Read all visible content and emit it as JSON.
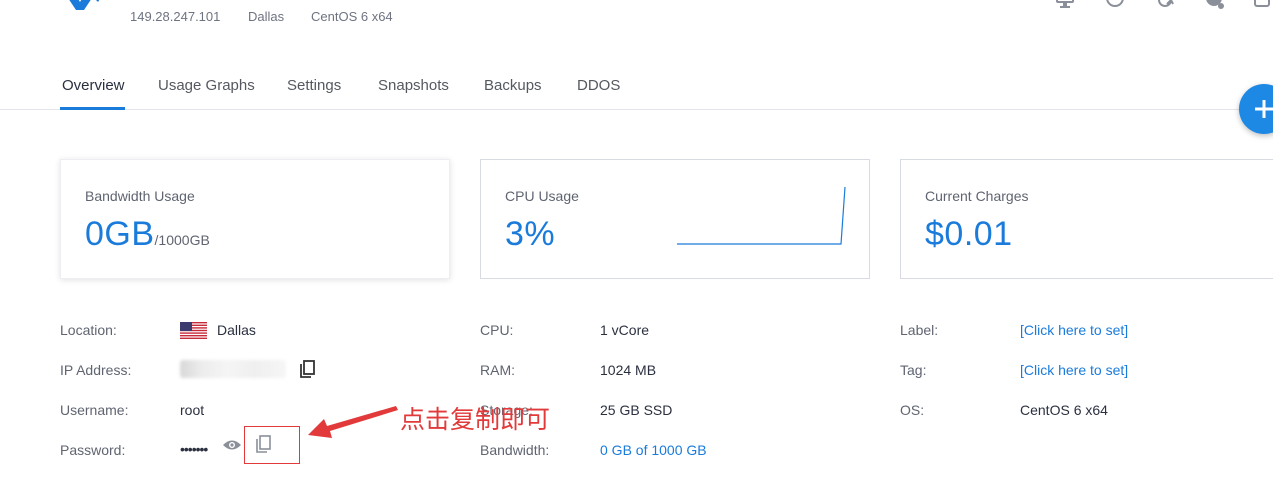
{
  "server": {
    "ip": "149.28.247.101",
    "location": "Dallas",
    "os": "CentOS 6 x64"
  },
  "header_icons": [
    "console-icon",
    "power-icon",
    "restart-icon",
    "reinstall-icon",
    "stop-icon"
  ],
  "tabs": [
    {
      "label": "Overview",
      "active": true
    },
    {
      "label": "Usage Graphs",
      "active": false
    },
    {
      "label": "Settings",
      "active": false
    },
    {
      "label": "Snapshots",
      "active": false
    },
    {
      "label": "Backups",
      "active": false
    },
    {
      "label": "DDOS",
      "active": false
    }
  ],
  "cards": {
    "bandwidth": {
      "title": "Bandwidth Usage",
      "value": "0GB",
      "sub": "/1000GB"
    },
    "cpu": {
      "title": "CPU Usage",
      "value": "3%"
    },
    "charges": {
      "title": "Current Charges",
      "value": "$0.01"
    }
  },
  "details": {
    "location": {
      "label": "Location:",
      "value": "Dallas"
    },
    "ip": {
      "label": "IP Address:"
    },
    "username": {
      "label": "Username:",
      "value": "root"
    },
    "password": {
      "label": "Password:",
      "value": "•••••••"
    },
    "cpu": {
      "label": "CPU:",
      "value": "1 vCore"
    },
    "ram": {
      "label": "RAM:",
      "value": "1024 MB"
    },
    "storage": {
      "label": "Storage:",
      "value": "25 GB SSD"
    },
    "bandwidth": {
      "label": "Bandwidth:",
      "value": "0 GB of 1000 GB"
    },
    "server_label": {
      "label": "Label:",
      "value": "[Click here to set]"
    },
    "tag": {
      "label": "Tag:",
      "value": "[Click here to set]"
    },
    "os": {
      "label": "OS:",
      "value": "CentOS 6 x64"
    }
  },
  "annotation": {
    "text": "点击复制即可"
  },
  "colors": {
    "accent": "#1a7bdb",
    "annotation": "#e23a3a"
  }
}
